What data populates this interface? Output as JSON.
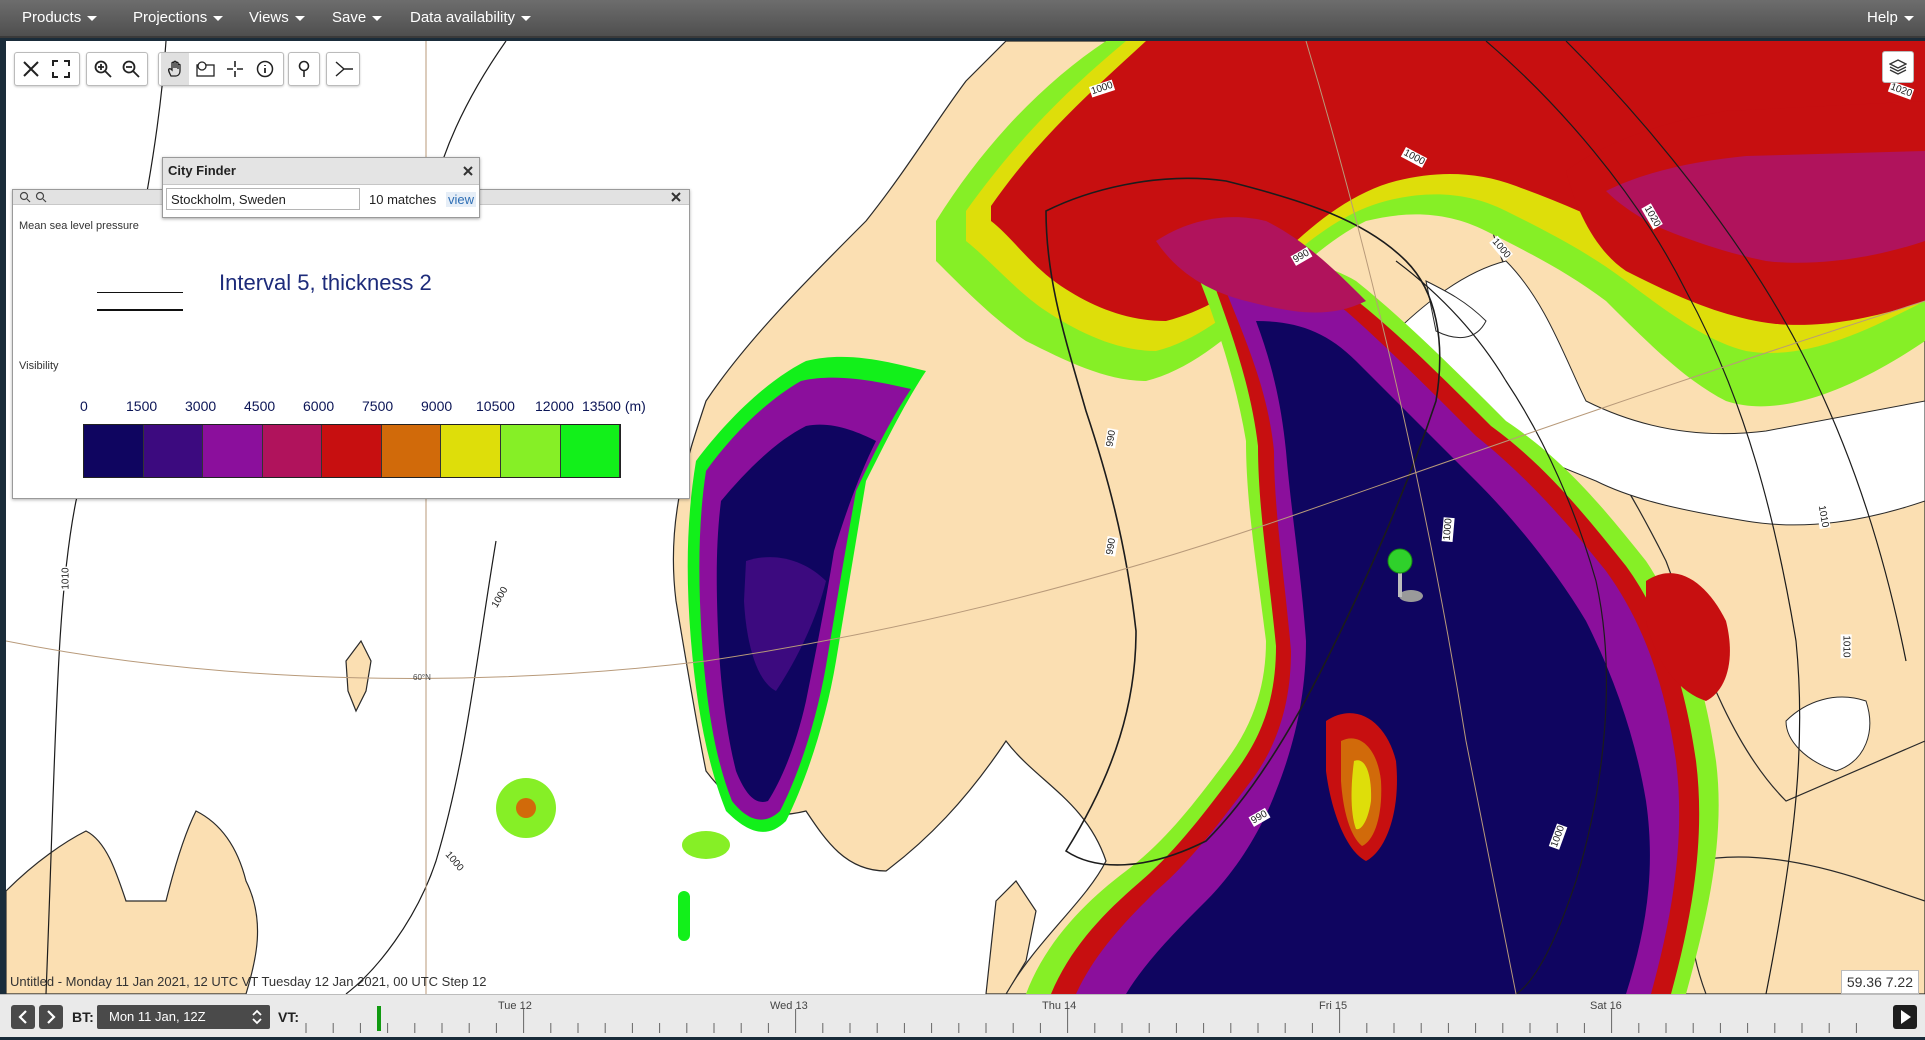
{
  "menu": {
    "left": [
      "Products",
      "Projections",
      "Views",
      "Save",
      "Data availability"
    ],
    "help": "Help"
  },
  "toolbar": {
    "icons": [
      "close-icon",
      "fullscreen-icon",
      "zoom-in-icon",
      "zoom-out-icon",
      "pan-hand-icon",
      "zoom-box-icon",
      "crosshair-icon",
      "info-icon",
      "location-pin-icon",
      "cross-section-icon"
    ]
  },
  "city_finder": {
    "title": "City Finder",
    "query": "Stockholm, Sweden",
    "matches": "10 matches",
    "view_link": "view"
  },
  "legend": {
    "mslp_label": "Mean sea level pressure",
    "mslp_style": "Interval 5, thickness 2",
    "visibility_label": "Visibility",
    "ticks": [
      "0",
      "1500",
      "3000",
      "4500",
      "6000",
      "7500",
      "9000",
      "10500",
      "12000",
      "13500 (m)"
    ],
    "colors": [
      "#0f0560",
      "#3c0a7f",
      "#8b0f9c",
      "#b0135c",
      "#c70f10",
      "#d16a0a",
      "#dede0a",
      "#86ef26",
      "#12f01a"
    ]
  },
  "map": {
    "isobar_labels": [
      "1000",
      "1000",
      "1000",
      "1000",
      "1020",
      "1010",
      "1000",
      "990",
      "990",
      "990",
      "1000",
      "1010",
      "1010",
      "1010",
      "1000",
      "990",
      "1000",
      "1010",
      "1000"
    ],
    "latitude_label": "60°N",
    "layers_icon": "layers-icon"
  },
  "status": {
    "text": "Untitled - Monday 11 Jan 2021, 12 UTC VT Tuesday 12 Jan 2021, 00 UTC Step 12",
    "coords": "59.36 7.22"
  },
  "timeline": {
    "bt_label": "BT:",
    "bt_value": "Mon 11 Jan, 12Z",
    "vt_label": "VT:",
    "days": [
      "Tue 12",
      "Wed 13",
      "Thu 14",
      "Fri 15",
      "Sat 16"
    ]
  }
}
